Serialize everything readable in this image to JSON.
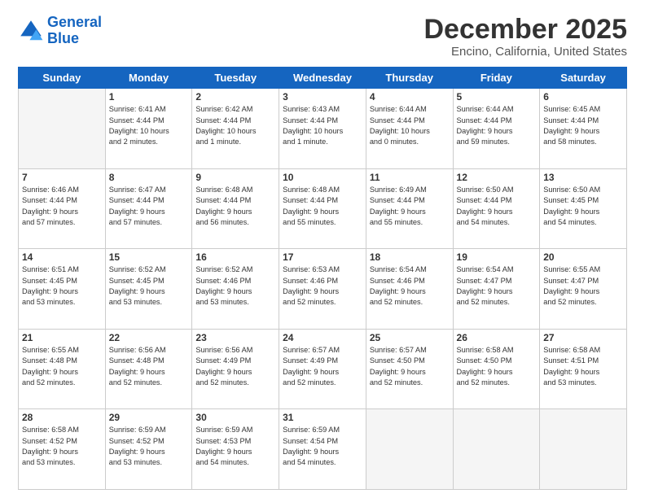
{
  "header": {
    "logo_line1": "General",
    "logo_line2": "Blue",
    "title": "December 2025",
    "subtitle": "Encino, California, United States"
  },
  "days_of_week": [
    "Sunday",
    "Monday",
    "Tuesday",
    "Wednesday",
    "Thursday",
    "Friday",
    "Saturday"
  ],
  "weeks": [
    [
      {
        "day": "",
        "info": ""
      },
      {
        "day": "1",
        "info": "Sunrise: 6:41 AM\nSunset: 4:44 PM\nDaylight: 10 hours\nand 2 minutes."
      },
      {
        "day": "2",
        "info": "Sunrise: 6:42 AM\nSunset: 4:44 PM\nDaylight: 10 hours\nand 1 minute."
      },
      {
        "day": "3",
        "info": "Sunrise: 6:43 AM\nSunset: 4:44 PM\nDaylight: 10 hours\nand 1 minute."
      },
      {
        "day": "4",
        "info": "Sunrise: 6:44 AM\nSunset: 4:44 PM\nDaylight: 10 hours\nand 0 minutes."
      },
      {
        "day": "5",
        "info": "Sunrise: 6:44 AM\nSunset: 4:44 PM\nDaylight: 9 hours\nand 59 minutes."
      },
      {
        "day": "6",
        "info": "Sunrise: 6:45 AM\nSunset: 4:44 PM\nDaylight: 9 hours\nand 58 minutes."
      }
    ],
    [
      {
        "day": "7",
        "info": "Sunrise: 6:46 AM\nSunset: 4:44 PM\nDaylight: 9 hours\nand 57 minutes."
      },
      {
        "day": "8",
        "info": "Sunrise: 6:47 AM\nSunset: 4:44 PM\nDaylight: 9 hours\nand 57 minutes."
      },
      {
        "day": "9",
        "info": "Sunrise: 6:48 AM\nSunset: 4:44 PM\nDaylight: 9 hours\nand 56 minutes."
      },
      {
        "day": "10",
        "info": "Sunrise: 6:48 AM\nSunset: 4:44 PM\nDaylight: 9 hours\nand 55 minutes."
      },
      {
        "day": "11",
        "info": "Sunrise: 6:49 AM\nSunset: 4:44 PM\nDaylight: 9 hours\nand 55 minutes."
      },
      {
        "day": "12",
        "info": "Sunrise: 6:50 AM\nSunset: 4:44 PM\nDaylight: 9 hours\nand 54 minutes."
      },
      {
        "day": "13",
        "info": "Sunrise: 6:50 AM\nSunset: 4:45 PM\nDaylight: 9 hours\nand 54 minutes."
      }
    ],
    [
      {
        "day": "14",
        "info": "Sunrise: 6:51 AM\nSunset: 4:45 PM\nDaylight: 9 hours\nand 53 minutes."
      },
      {
        "day": "15",
        "info": "Sunrise: 6:52 AM\nSunset: 4:45 PM\nDaylight: 9 hours\nand 53 minutes."
      },
      {
        "day": "16",
        "info": "Sunrise: 6:52 AM\nSunset: 4:46 PM\nDaylight: 9 hours\nand 53 minutes."
      },
      {
        "day": "17",
        "info": "Sunrise: 6:53 AM\nSunset: 4:46 PM\nDaylight: 9 hours\nand 52 minutes."
      },
      {
        "day": "18",
        "info": "Sunrise: 6:54 AM\nSunset: 4:46 PM\nDaylight: 9 hours\nand 52 minutes."
      },
      {
        "day": "19",
        "info": "Sunrise: 6:54 AM\nSunset: 4:47 PM\nDaylight: 9 hours\nand 52 minutes."
      },
      {
        "day": "20",
        "info": "Sunrise: 6:55 AM\nSunset: 4:47 PM\nDaylight: 9 hours\nand 52 minutes."
      }
    ],
    [
      {
        "day": "21",
        "info": "Sunrise: 6:55 AM\nSunset: 4:48 PM\nDaylight: 9 hours\nand 52 minutes."
      },
      {
        "day": "22",
        "info": "Sunrise: 6:56 AM\nSunset: 4:48 PM\nDaylight: 9 hours\nand 52 minutes."
      },
      {
        "day": "23",
        "info": "Sunrise: 6:56 AM\nSunset: 4:49 PM\nDaylight: 9 hours\nand 52 minutes."
      },
      {
        "day": "24",
        "info": "Sunrise: 6:57 AM\nSunset: 4:49 PM\nDaylight: 9 hours\nand 52 minutes."
      },
      {
        "day": "25",
        "info": "Sunrise: 6:57 AM\nSunset: 4:50 PM\nDaylight: 9 hours\nand 52 minutes."
      },
      {
        "day": "26",
        "info": "Sunrise: 6:58 AM\nSunset: 4:50 PM\nDaylight: 9 hours\nand 52 minutes."
      },
      {
        "day": "27",
        "info": "Sunrise: 6:58 AM\nSunset: 4:51 PM\nDaylight: 9 hours\nand 53 minutes."
      }
    ],
    [
      {
        "day": "28",
        "info": "Sunrise: 6:58 AM\nSunset: 4:52 PM\nDaylight: 9 hours\nand 53 minutes."
      },
      {
        "day": "29",
        "info": "Sunrise: 6:59 AM\nSunset: 4:52 PM\nDaylight: 9 hours\nand 53 minutes."
      },
      {
        "day": "30",
        "info": "Sunrise: 6:59 AM\nSunset: 4:53 PM\nDaylight: 9 hours\nand 54 minutes."
      },
      {
        "day": "31",
        "info": "Sunrise: 6:59 AM\nSunset: 4:54 PM\nDaylight: 9 hours\nand 54 minutes."
      },
      {
        "day": "",
        "info": ""
      },
      {
        "day": "",
        "info": ""
      },
      {
        "day": "",
        "info": ""
      }
    ]
  ]
}
